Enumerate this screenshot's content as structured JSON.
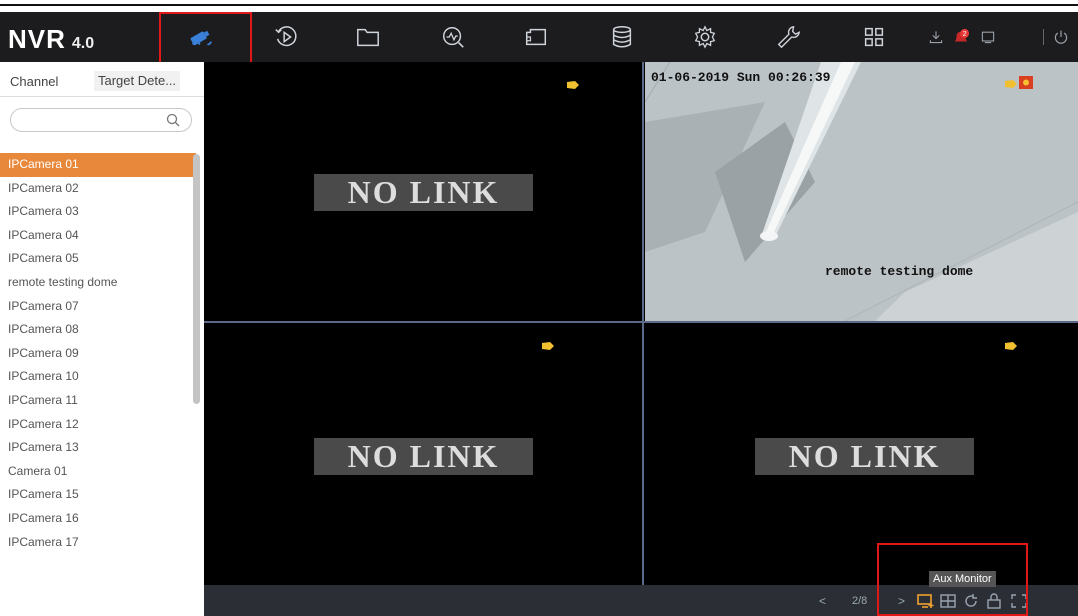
{
  "app": {
    "logo": "NVR",
    "version": "4.0"
  },
  "nav": {
    "icons": [
      "live-view-icon",
      "playback-icon",
      "file-icon",
      "smart-analysis-icon",
      "intelligent-icon",
      "storage-icon",
      "settings-icon",
      "maintenance-icon",
      "grid-menu-icon"
    ],
    "right_icons": [
      "download-icon",
      "alarm-icon",
      "record-icon",
      "power-icon"
    ],
    "alarm_count": "2"
  },
  "sidebar": {
    "tabs": [
      "Channel",
      "Target Dete..."
    ],
    "search_placeholder": "",
    "items": [
      "IPCamera 01",
      "IPCamera 02",
      "IPCamera 03",
      "IPCamera 04",
      "IPCamera 05",
      "remote testing dome",
      "IPCamera 07",
      "IPCamera 08",
      "IPCamera 09",
      "IPCamera 10",
      "IPCamera 11",
      "IPCamera 12",
      "IPCamera 13",
      "Camera 01",
      "IPCamera 15",
      "IPCamera 16",
      "IPCamera 17"
    ],
    "selected": "IPCamera 01"
  },
  "views": {
    "nolink": "NO LINK",
    "camera": {
      "timestamp": "01-06-2019 Sun 00:26:39",
      "name": "remote testing dome"
    }
  },
  "status": {
    "tooltip": "Aux Monitor",
    "page": "2/8",
    "prev": "<",
    "next": ">"
  },
  "colors": {
    "accent": "#e8883a",
    "topbar": "#1c1c1e",
    "highlight": "#e01818"
  }
}
